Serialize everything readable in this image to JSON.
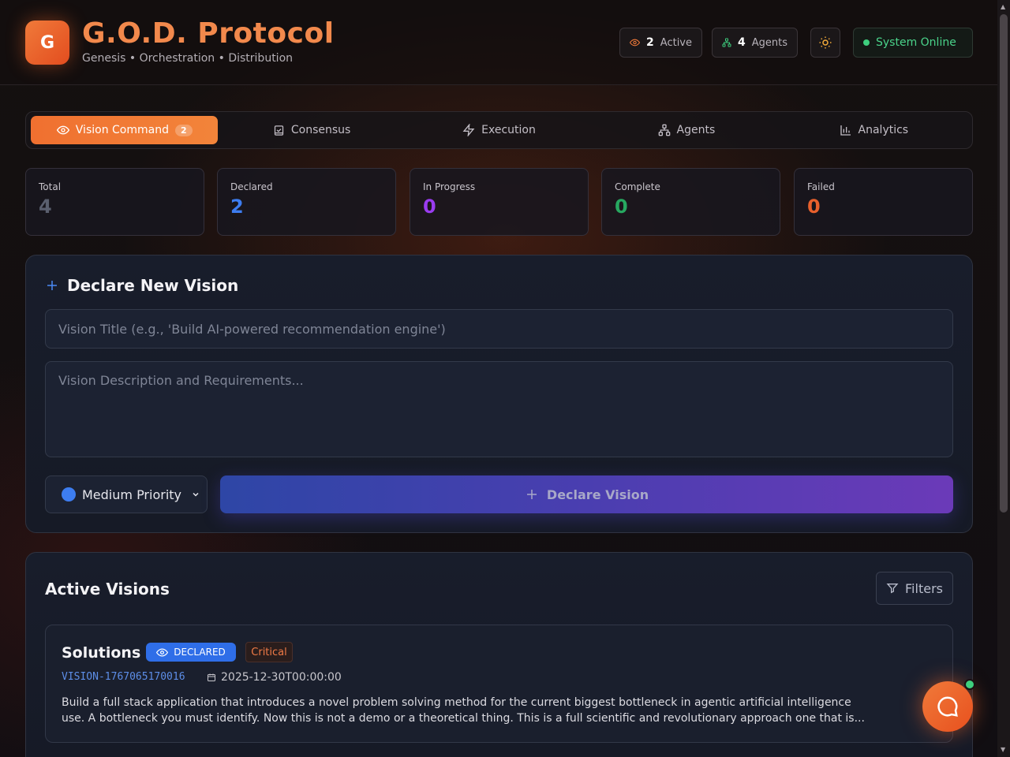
{
  "app": {
    "logo_letter": "G",
    "title": "G.O.D. Protocol",
    "subtitle": "Genesis • Orchestration • Distribution"
  },
  "header": {
    "active_count": "2",
    "active_label": "Active",
    "agents_count": "4",
    "agents_label": "Agents",
    "status": "System Online"
  },
  "tabs": [
    {
      "label": "Vision Command",
      "badge": "2",
      "icon": "eye-icon",
      "active": true
    },
    {
      "label": "Consensus",
      "icon": "vote-icon"
    },
    {
      "label": "Execution",
      "icon": "lightning-icon"
    },
    {
      "label": "Agents",
      "icon": "network-icon"
    },
    {
      "label": "Analytics",
      "icon": "bar-chart-icon"
    }
  ],
  "stats": [
    {
      "label": "Total",
      "value": "4",
      "color": "#5a5f6e"
    },
    {
      "label": "Declared",
      "value": "2",
      "color": "#3d7df0"
    },
    {
      "label": "In Progress",
      "value": "0",
      "color": "#9a3cf0"
    },
    {
      "label": "Complete",
      "value": "0",
      "color": "#27a860"
    },
    {
      "label": "Failed",
      "value": "0",
      "color": "#e8602c"
    }
  ],
  "declare": {
    "title": "Declare New Vision",
    "title_placeholder": "Vision Title (e.g., 'Build AI-powered recommendation engine')",
    "desc_placeholder": "Vision Description and Requirements...",
    "priority": "Medium Priority",
    "button": "Declare Vision"
  },
  "visions": {
    "title": "Active Visions",
    "filters": "Filters",
    "items": [
      {
        "name": "Solutions",
        "status": "DECLARED",
        "priority": "Critical",
        "id": "VISION-1767065170016",
        "date": "2025-12-30T00:00:00",
        "description": "Build a full stack application that introduces a novel problem solving method for the current biggest bottleneck in agentic artificial intelligence use. A bottleneck you must identify. Now this is not a demo or a theoretical thing. This is a full scientific and revolutionary approach one that is..."
      }
    ]
  },
  "colors": {
    "accent": "#f07a3a",
    "declared": "#2f6ee8",
    "online": "#3ecf7e"
  }
}
